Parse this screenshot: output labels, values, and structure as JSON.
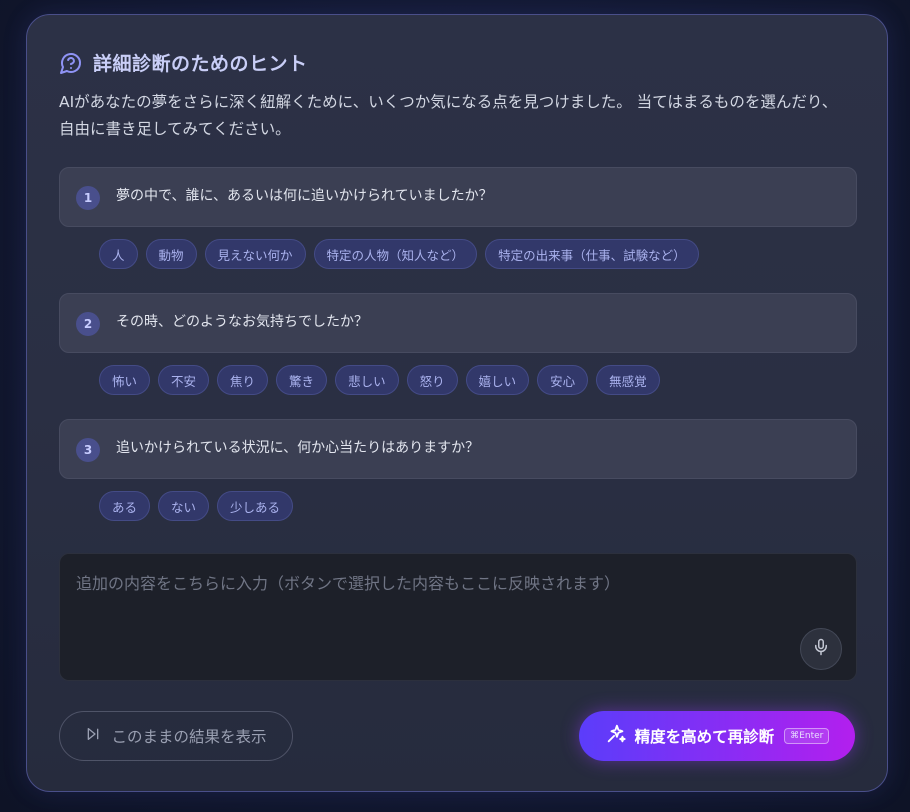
{
  "header": {
    "icon": "question-bubble-icon",
    "title": "詳細診断のためのヒント"
  },
  "description": "AIがあなたの夢をさらに深く紐解くために、いくつか気になる点を見つけました。 当てはまるものを選んだり、自由に書き足してみてください。",
  "questions": [
    {
      "number": "1",
      "text": "夢の中で、誰に、あるいは何に追いかけられていましたか？",
      "options": [
        "人",
        "動物",
        "見えない何か",
        "特定の人物（知人など）",
        "特定の出来事（仕事、試験など）"
      ]
    },
    {
      "number": "2",
      "text": "その時、どのようなお気持ちでしたか？",
      "options": [
        "怖い",
        "不安",
        "焦り",
        "驚き",
        "悲しい",
        "怒り",
        "嬉しい",
        "安心",
        "無感覚"
      ]
    },
    {
      "number": "3",
      "text": "追いかけられている状況に、何か心当たりはありますか？",
      "options": [
        "ある",
        "ない",
        "少しある"
      ]
    }
  ],
  "input": {
    "value": "",
    "placeholder": "追加の内容をこちらに入力（ボタンで選択した内容もここに反映されます）",
    "mic_icon": "microphone-icon"
  },
  "actions": {
    "show_result_label": "このままの結果を表示",
    "show_result_icon": "skip-forward-icon",
    "rediagnose_label": "精度を高めて再診断",
    "rediagnose_icon": "sparkles-icon",
    "shortcut": "⌘Enter"
  },
  "colors": {
    "accent_start": "#5b3dfa",
    "accent_end": "#b31fee",
    "chip_text": "#aab2ee",
    "title": "#c9cef7"
  }
}
